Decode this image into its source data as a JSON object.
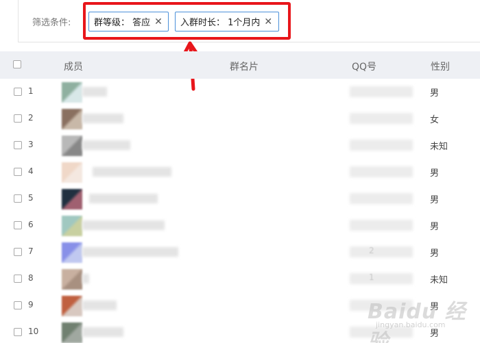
{
  "filter": {
    "label": "筛选条件:",
    "chips": [
      {
        "text": "群等级： 答应",
        "remove": "✕"
      },
      {
        "text": "入群时长： 1个月内",
        "remove": "✕"
      }
    ]
  },
  "table": {
    "headers": {
      "member": "成员",
      "card": "群名片",
      "qq": "QQ号",
      "gender": "性别"
    },
    "rows": [
      {
        "index": "1",
        "gender": "男"
      },
      {
        "index": "2",
        "gender": "女"
      },
      {
        "index": "3",
        "gender": "未知"
      },
      {
        "index": "4",
        "gender": "男"
      },
      {
        "index": "5",
        "gender": "男"
      },
      {
        "index": "6",
        "gender": "男"
      },
      {
        "index": "7",
        "gender": "男",
        "qq_hint": "2"
      },
      {
        "index": "8",
        "gender": "未知",
        "qq_hint": "1"
      },
      {
        "index": "9",
        "gender": "男"
      },
      {
        "index": "10",
        "gender": "男"
      }
    ]
  },
  "watermark": {
    "text": "Baidu 经验",
    "sub": "jingyan.baidu.com"
  },
  "colors": {
    "highlight": "#e8161b",
    "chip_border": "#4a90d9",
    "header_bg": "#eef0f4"
  }
}
